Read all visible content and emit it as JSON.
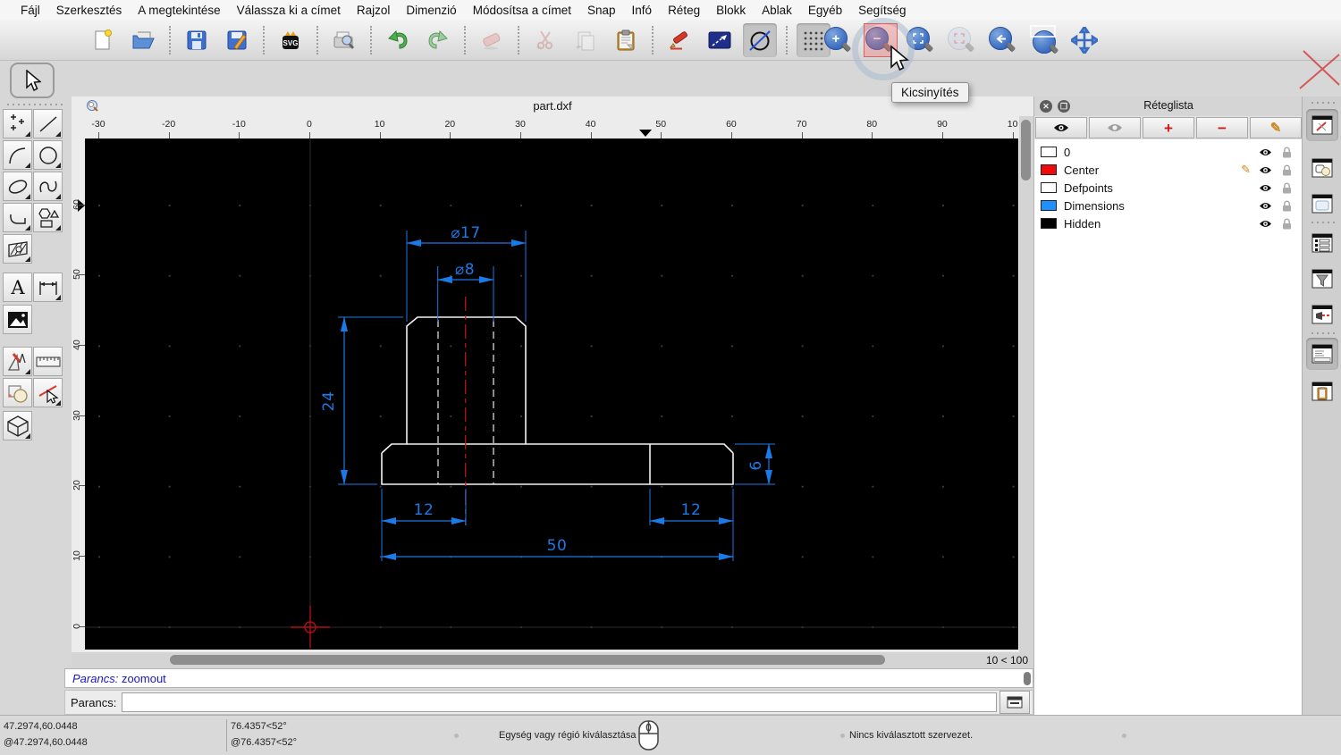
{
  "menu": {
    "items": [
      "Fájl",
      "Szerkesztés",
      "A megtekintése",
      "Válassza ki a címet",
      "Rajzol",
      "Dimenzió",
      "Módosítsa a címet",
      "Snap",
      "Infó",
      "Réteg",
      "Blokk",
      "Ablak",
      "Egyéb",
      "Segítség"
    ]
  },
  "toolbar": {
    "zoom_tooltip": "Kicsinyítés"
  },
  "tab": {
    "title": "part.dxf"
  },
  "rulers": {
    "horizontal": [
      "-30",
      "-20",
      "-10",
      "0",
      "10",
      "20",
      "30",
      "40",
      "50",
      "60",
      "70",
      "80",
      "90",
      "10"
    ],
    "vertical": [
      "60",
      "50",
      "40",
      "30",
      "20",
      "10",
      "0"
    ]
  },
  "drawing": {
    "dims": {
      "boss_diameter": "⌀17",
      "hole_diameter": "⌀8",
      "height": "24",
      "left_offset": "12",
      "right_offset": "12",
      "total_width": "50",
      "base_height": "6"
    },
    "colors": {
      "dimension": "#1a7ae6",
      "outline": "#f2f2f2",
      "centerline": "#c81414"
    }
  },
  "scroll": {
    "zoom_indicator": "10 < 100"
  },
  "command": {
    "history_label": "Parancs:",
    "history_value": "zoomout",
    "prompt_label": "Parancs:",
    "input_value": ""
  },
  "statusbar": {
    "abs_coord": "47.2974,60.0448",
    "rel_coord": "@47.2974,60.0448",
    "abs_polar": "76.4357<52°",
    "rel_polar": "@76.4357<52°",
    "mouse_left_hint": "Egység vagy régió kiválasztása",
    "selection_status": "Nincs kiválasztott szervezet."
  },
  "layer_panel": {
    "title": "Réteglista",
    "layers": [
      {
        "name": "0",
        "color": "#ffffff",
        "editing": false
      },
      {
        "name": "Center",
        "color": "#f00a0a",
        "editing": true
      },
      {
        "name": "Defpoints",
        "color": "#ffffff",
        "editing": false
      },
      {
        "name": "Dimensions",
        "color": "#1e90ff",
        "editing": false
      },
      {
        "name": "Hidden",
        "color": "#000000",
        "editing": false
      }
    ]
  }
}
